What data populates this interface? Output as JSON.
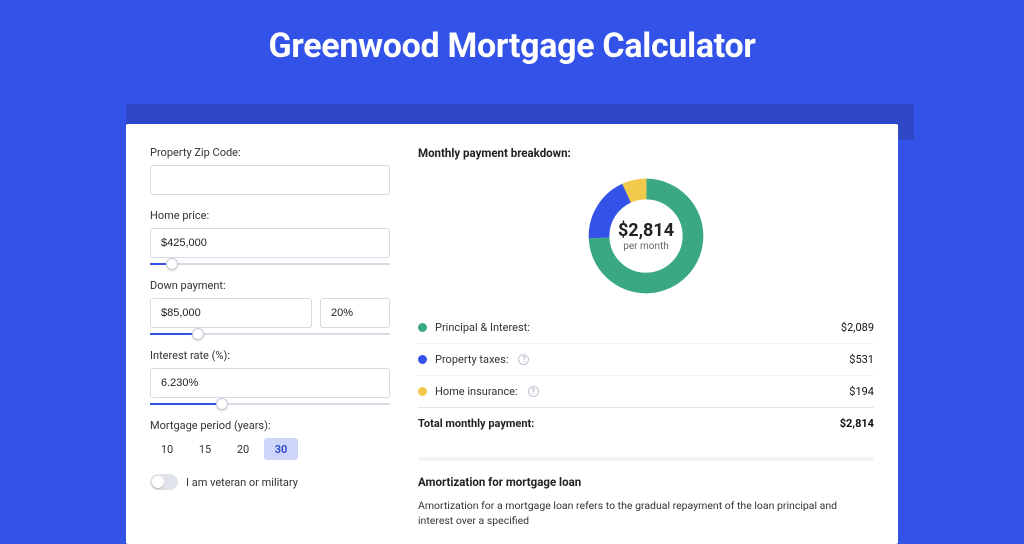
{
  "page_title": "Greenwood Mortgage Calculator",
  "colors": {
    "principal": "#3aa981",
    "taxes": "#3353e8",
    "insurance": "#f1c94b"
  },
  "form": {
    "zip": {
      "label": "Property Zip Code:",
      "value": ""
    },
    "home_price": {
      "label": "Home price:",
      "value": "$425,000",
      "slider_pct": 9
    },
    "down_payment": {
      "label": "Down payment:",
      "amount": "$85,000",
      "percent": "20%",
      "slider_pct": 20
    },
    "interest_rate": {
      "label": "Interest rate (%):",
      "value": "6.230%",
      "slider_pct": 30
    },
    "period": {
      "label": "Mortgage period (years):",
      "options": [
        "10",
        "15",
        "20",
        "30"
      ],
      "selected": "30"
    },
    "veteran": {
      "label": "I am veteran or military",
      "on": false
    }
  },
  "results": {
    "title": "Monthly payment breakdown:",
    "center_amount": "$2,814",
    "center_sub": "per month",
    "rows": [
      {
        "key": "principal",
        "label": "Principal & Interest:",
        "value": "$2,089",
        "num": 2089,
        "info": false
      },
      {
        "key": "taxes",
        "label": "Property taxes:",
        "value": "$531",
        "num": 531,
        "info": true
      },
      {
        "key": "insurance",
        "label": "Home insurance:",
        "value": "$194",
        "num": 194,
        "info": true
      }
    ],
    "total_label": "Total monthly payment:",
    "total_value": "$2,814"
  },
  "chart_data": {
    "type": "pie",
    "title": "Monthly payment breakdown",
    "categories": [
      "Principal & Interest",
      "Property taxes",
      "Home insurance"
    ],
    "values": [
      2089,
      531,
      194
    ],
    "colors": [
      "#3aa981",
      "#3353e8",
      "#f1c94b"
    ],
    "center_label": "$2,814 per month"
  },
  "amortization": {
    "title": "Amortization for mortgage loan",
    "text": "Amortization for a mortgage loan refers to the gradual repayment of the loan principal and interest over a specified"
  }
}
